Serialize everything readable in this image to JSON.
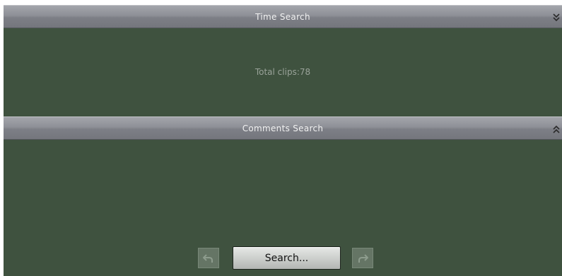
{
  "time_search": {
    "title": "Time Search",
    "toggle_icon": "chevron-double-down-icon",
    "total_clips_text": "Total clips:78"
  },
  "comments_search": {
    "title": "Comments Search",
    "toggle_icon": "chevron-double-up-icon"
  },
  "actions": {
    "search_label": "Search...",
    "prev_icon": "undo-arrow-icon",
    "next_icon": "redo-arrow-icon"
  },
  "colors": {
    "panel_body": "#3f523f",
    "header": "#8e9097"
  }
}
